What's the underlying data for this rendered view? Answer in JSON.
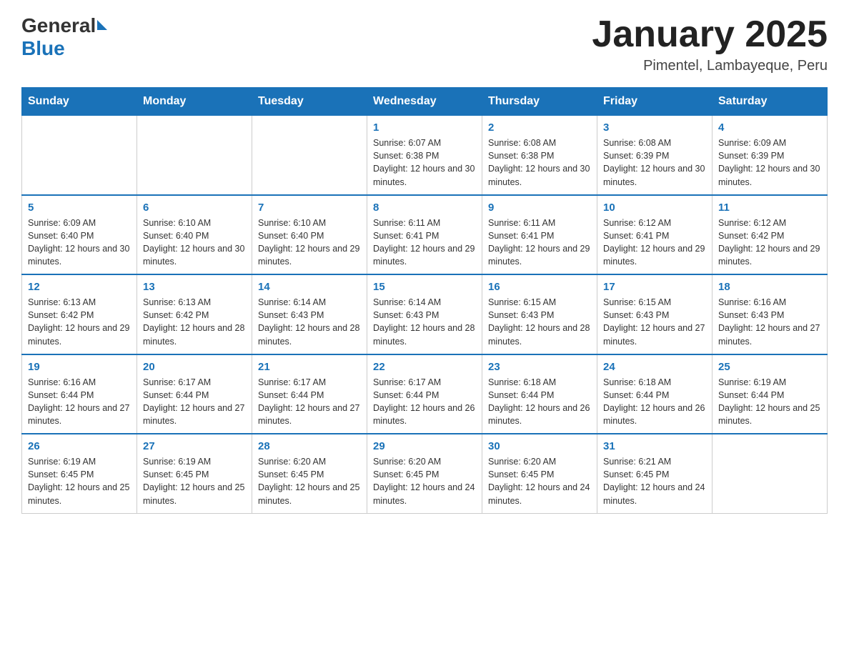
{
  "header": {
    "logo_general": "General",
    "logo_blue": "Blue",
    "month_title": "January 2025",
    "location": "Pimentel, Lambayeque, Peru"
  },
  "days_of_week": [
    "Sunday",
    "Monday",
    "Tuesday",
    "Wednesday",
    "Thursday",
    "Friday",
    "Saturday"
  ],
  "weeks": [
    [
      {
        "day": "",
        "info": ""
      },
      {
        "day": "",
        "info": ""
      },
      {
        "day": "",
        "info": ""
      },
      {
        "day": "1",
        "info": "Sunrise: 6:07 AM\nSunset: 6:38 PM\nDaylight: 12 hours and 30 minutes."
      },
      {
        "day": "2",
        "info": "Sunrise: 6:08 AM\nSunset: 6:38 PM\nDaylight: 12 hours and 30 minutes."
      },
      {
        "day": "3",
        "info": "Sunrise: 6:08 AM\nSunset: 6:39 PM\nDaylight: 12 hours and 30 minutes."
      },
      {
        "day": "4",
        "info": "Sunrise: 6:09 AM\nSunset: 6:39 PM\nDaylight: 12 hours and 30 minutes."
      }
    ],
    [
      {
        "day": "5",
        "info": "Sunrise: 6:09 AM\nSunset: 6:40 PM\nDaylight: 12 hours and 30 minutes."
      },
      {
        "day": "6",
        "info": "Sunrise: 6:10 AM\nSunset: 6:40 PM\nDaylight: 12 hours and 30 minutes."
      },
      {
        "day": "7",
        "info": "Sunrise: 6:10 AM\nSunset: 6:40 PM\nDaylight: 12 hours and 29 minutes."
      },
      {
        "day": "8",
        "info": "Sunrise: 6:11 AM\nSunset: 6:41 PM\nDaylight: 12 hours and 29 minutes."
      },
      {
        "day": "9",
        "info": "Sunrise: 6:11 AM\nSunset: 6:41 PM\nDaylight: 12 hours and 29 minutes."
      },
      {
        "day": "10",
        "info": "Sunrise: 6:12 AM\nSunset: 6:41 PM\nDaylight: 12 hours and 29 minutes."
      },
      {
        "day": "11",
        "info": "Sunrise: 6:12 AM\nSunset: 6:42 PM\nDaylight: 12 hours and 29 minutes."
      }
    ],
    [
      {
        "day": "12",
        "info": "Sunrise: 6:13 AM\nSunset: 6:42 PM\nDaylight: 12 hours and 29 minutes."
      },
      {
        "day": "13",
        "info": "Sunrise: 6:13 AM\nSunset: 6:42 PM\nDaylight: 12 hours and 28 minutes."
      },
      {
        "day": "14",
        "info": "Sunrise: 6:14 AM\nSunset: 6:43 PM\nDaylight: 12 hours and 28 minutes."
      },
      {
        "day": "15",
        "info": "Sunrise: 6:14 AM\nSunset: 6:43 PM\nDaylight: 12 hours and 28 minutes."
      },
      {
        "day": "16",
        "info": "Sunrise: 6:15 AM\nSunset: 6:43 PM\nDaylight: 12 hours and 28 minutes."
      },
      {
        "day": "17",
        "info": "Sunrise: 6:15 AM\nSunset: 6:43 PM\nDaylight: 12 hours and 27 minutes."
      },
      {
        "day": "18",
        "info": "Sunrise: 6:16 AM\nSunset: 6:43 PM\nDaylight: 12 hours and 27 minutes."
      }
    ],
    [
      {
        "day": "19",
        "info": "Sunrise: 6:16 AM\nSunset: 6:44 PM\nDaylight: 12 hours and 27 minutes."
      },
      {
        "day": "20",
        "info": "Sunrise: 6:17 AM\nSunset: 6:44 PM\nDaylight: 12 hours and 27 minutes."
      },
      {
        "day": "21",
        "info": "Sunrise: 6:17 AM\nSunset: 6:44 PM\nDaylight: 12 hours and 27 minutes."
      },
      {
        "day": "22",
        "info": "Sunrise: 6:17 AM\nSunset: 6:44 PM\nDaylight: 12 hours and 26 minutes."
      },
      {
        "day": "23",
        "info": "Sunrise: 6:18 AM\nSunset: 6:44 PM\nDaylight: 12 hours and 26 minutes."
      },
      {
        "day": "24",
        "info": "Sunrise: 6:18 AM\nSunset: 6:44 PM\nDaylight: 12 hours and 26 minutes."
      },
      {
        "day": "25",
        "info": "Sunrise: 6:19 AM\nSunset: 6:44 PM\nDaylight: 12 hours and 25 minutes."
      }
    ],
    [
      {
        "day": "26",
        "info": "Sunrise: 6:19 AM\nSunset: 6:45 PM\nDaylight: 12 hours and 25 minutes."
      },
      {
        "day": "27",
        "info": "Sunrise: 6:19 AM\nSunset: 6:45 PM\nDaylight: 12 hours and 25 minutes."
      },
      {
        "day": "28",
        "info": "Sunrise: 6:20 AM\nSunset: 6:45 PM\nDaylight: 12 hours and 25 minutes."
      },
      {
        "day": "29",
        "info": "Sunrise: 6:20 AM\nSunset: 6:45 PM\nDaylight: 12 hours and 24 minutes."
      },
      {
        "day": "30",
        "info": "Sunrise: 6:20 AM\nSunset: 6:45 PM\nDaylight: 12 hours and 24 minutes."
      },
      {
        "day": "31",
        "info": "Sunrise: 6:21 AM\nSunset: 6:45 PM\nDaylight: 12 hours and 24 minutes."
      },
      {
        "day": "",
        "info": ""
      }
    ]
  ]
}
